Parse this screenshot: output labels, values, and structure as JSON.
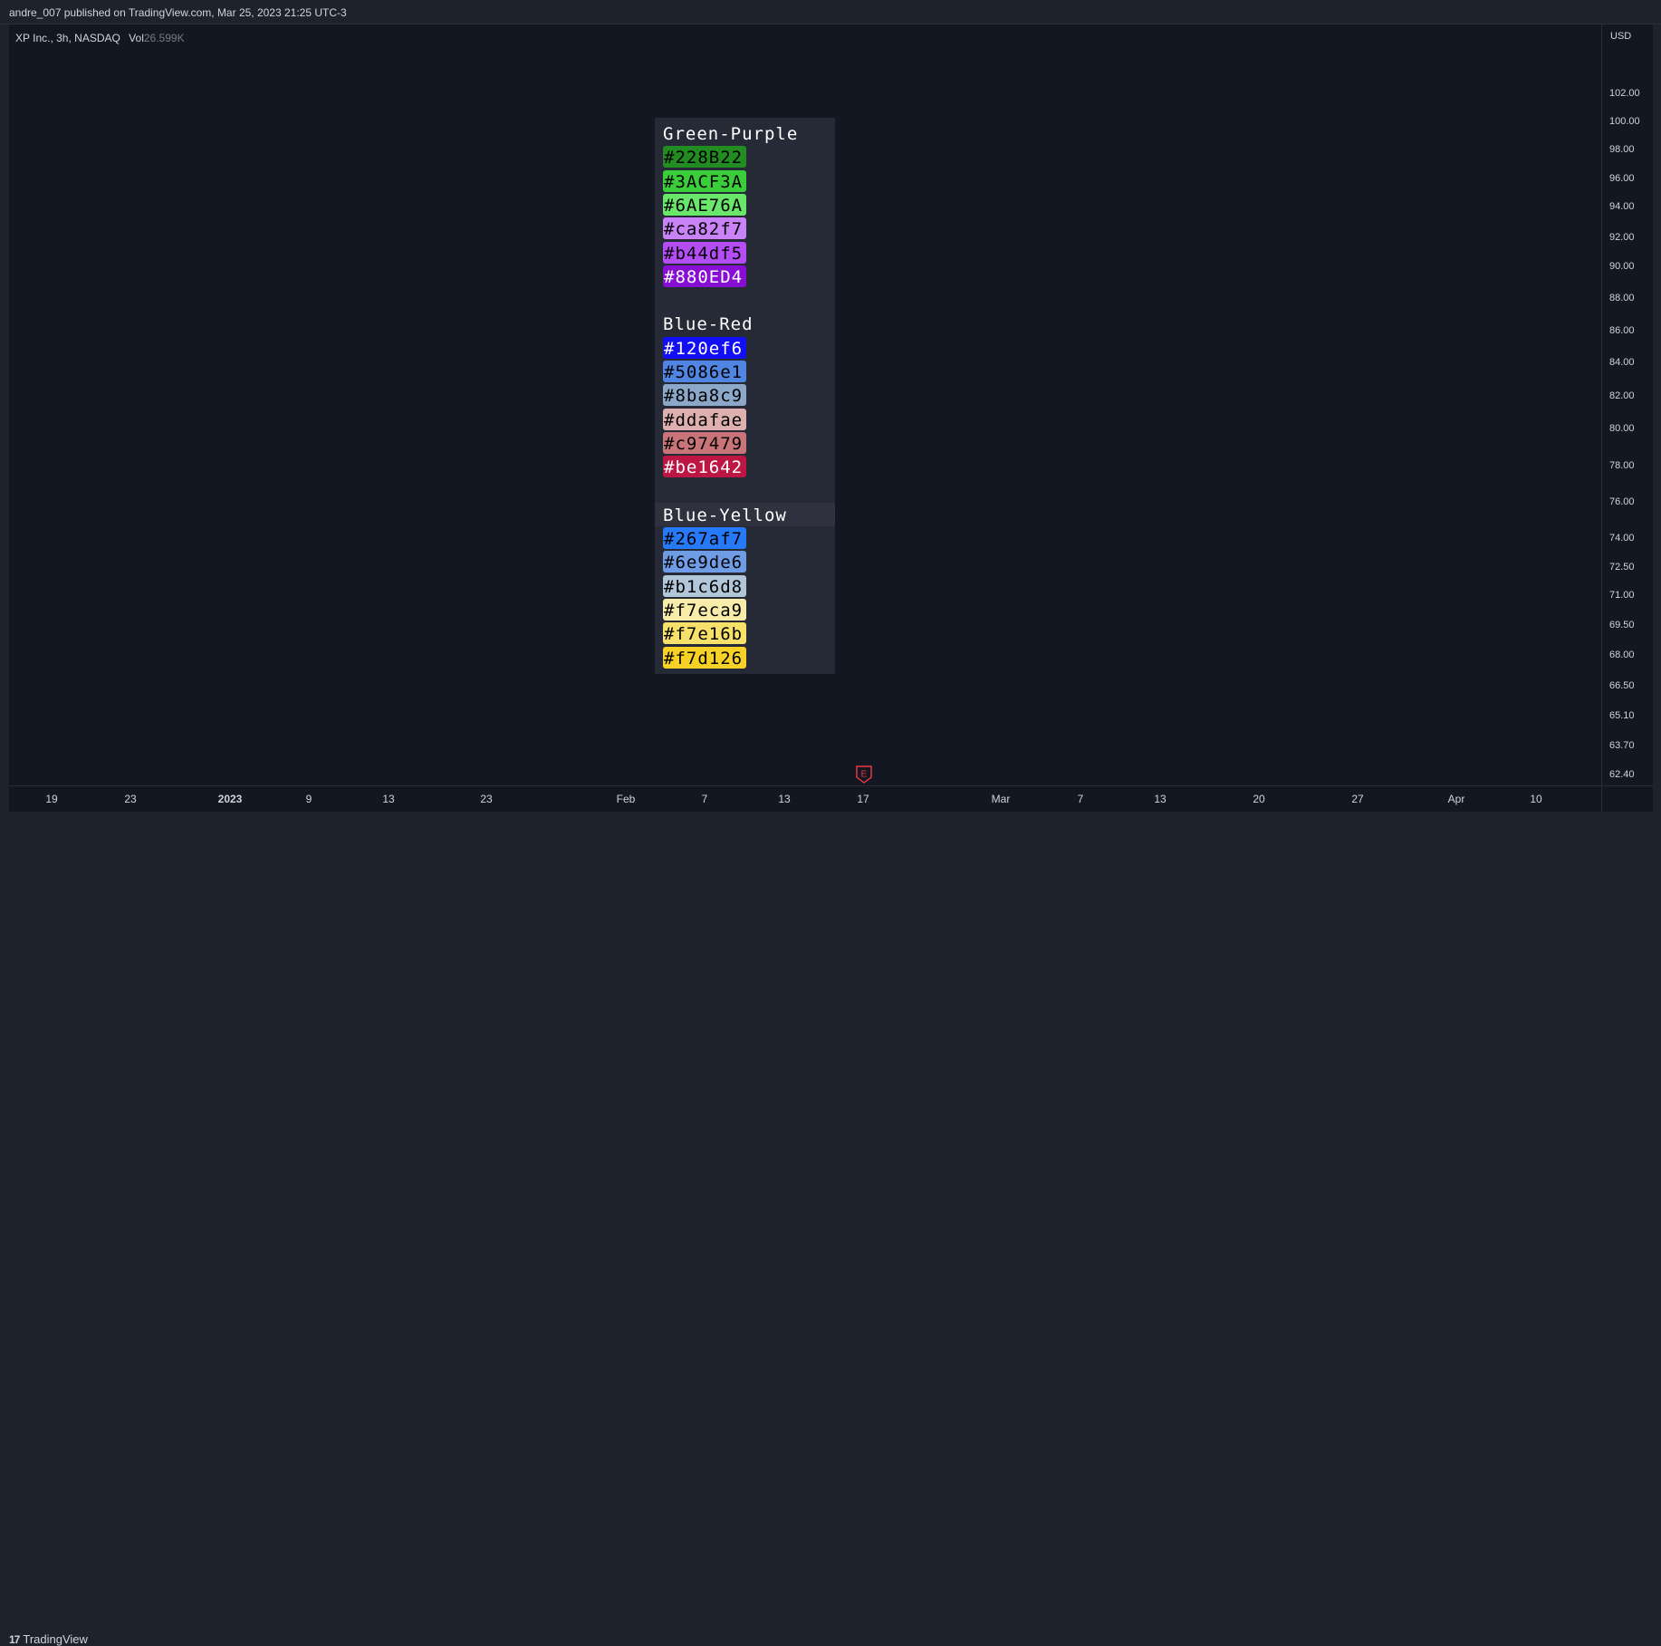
{
  "header": {
    "publish_text": "andre_007 published on TradingView.com, Mar 25, 2023 21:25 UTC-3"
  },
  "legend": {
    "symbol": "XP Inc., 3h, NASDAQ",
    "vol_label": "Vol",
    "vol_value": "26.599K"
  },
  "brand": {
    "name": "TradingView",
    "icon_glyph": "17"
  },
  "earnings_marker": {
    "label": "E",
    "color": "#f23645"
  },
  "chart_data": {
    "type": "table",
    "y_axis": {
      "currency": "USD",
      "ticks": [
        "102.00",
        "100.00",
        "98.00",
        "96.00",
        "94.00",
        "92.00",
        "90.00",
        "88.00",
        "86.00",
        "84.00",
        "82.00",
        "80.00",
        "78.00",
        "76.00",
        "74.00",
        "72.50",
        "71.00",
        "69.50",
        "68.00",
        "66.50",
        "65.10",
        "63.70",
        "62.40"
      ]
    },
    "x_axis": {
      "ticks": [
        {
          "label": "19",
          "major": false
        },
        {
          "label": "23",
          "major": false
        },
        {
          "label": "2023",
          "major": true
        },
        {
          "label": "9",
          "major": false
        },
        {
          "label": "13",
          "major": false
        },
        {
          "label": "23",
          "major": false
        },
        {
          "label": "Feb",
          "major": false
        },
        {
          "label": "7",
          "major": false
        },
        {
          "label": "13",
          "major": false
        },
        {
          "label": "17",
          "major": false
        },
        {
          "label": "Mar",
          "major": false
        },
        {
          "label": "7",
          "major": false
        },
        {
          "label": "13",
          "major": false
        },
        {
          "label": "20",
          "major": false
        },
        {
          "label": "27",
          "major": false
        },
        {
          "label": "Apr",
          "major": false
        },
        {
          "label": "10",
          "major": false
        }
      ]
    },
    "palettes": [
      {
        "name": "Green-Purple",
        "colors": [
          {
            "hex": "#228B22",
            "text_color": "#000000"
          },
          {
            "hex": "#3ACF3A",
            "text_color": "#000000"
          },
          {
            "hex": "#6AE76A",
            "text_color": "#000000"
          },
          {
            "hex": "#ca82f7",
            "text_color": "#000000"
          },
          {
            "hex": "#b44df5",
            "text_color": "#000000"
          },
          {
            "hex": "#880ED4",
            "text_color": "#ffffff"
          }
        ]
      },
      {
        "name": "Blue-Red",
        "colors": [
          {
            "hex": "#120ef6",
            "text_color": "#ffffff"
          },
          {
            "hex": "#5086e1",
            "text_color": "#000000"
          },
          {
            "hex": "#8ba8c9",
            "text_color": "#000000"
          },
          {
            "hex": "#ddafae",
            "text_color": "#000000"
          },
          {
            "hex": "#c97479",
            "text_color": "#000000"
          },
          {
            "hex": "#be1642",
            "text_color": "#ffffff"
          }
        ]
      },
      {
        "name": "Blue-Yellow",
        "colors": [
          {
            "hex": "#267af7",
            "text_color": "#000000"
          },
          {
            "hex": "#6e9de6",
            "text_color": "#000000"
          },
          {
            "hex": "#b1c6d8",
            "text_color": "#000000"
          },
          {
            "hex": "#f7eca9",
            "text_color": "#000000"
          },
          {
            "hex": "#f7e16b",
            "text_color": "#000000"
          },
          {
            "hex": "#f7d126",
            "text_color": "#000000"
          }
        ]
      }
    ]
  }
}
